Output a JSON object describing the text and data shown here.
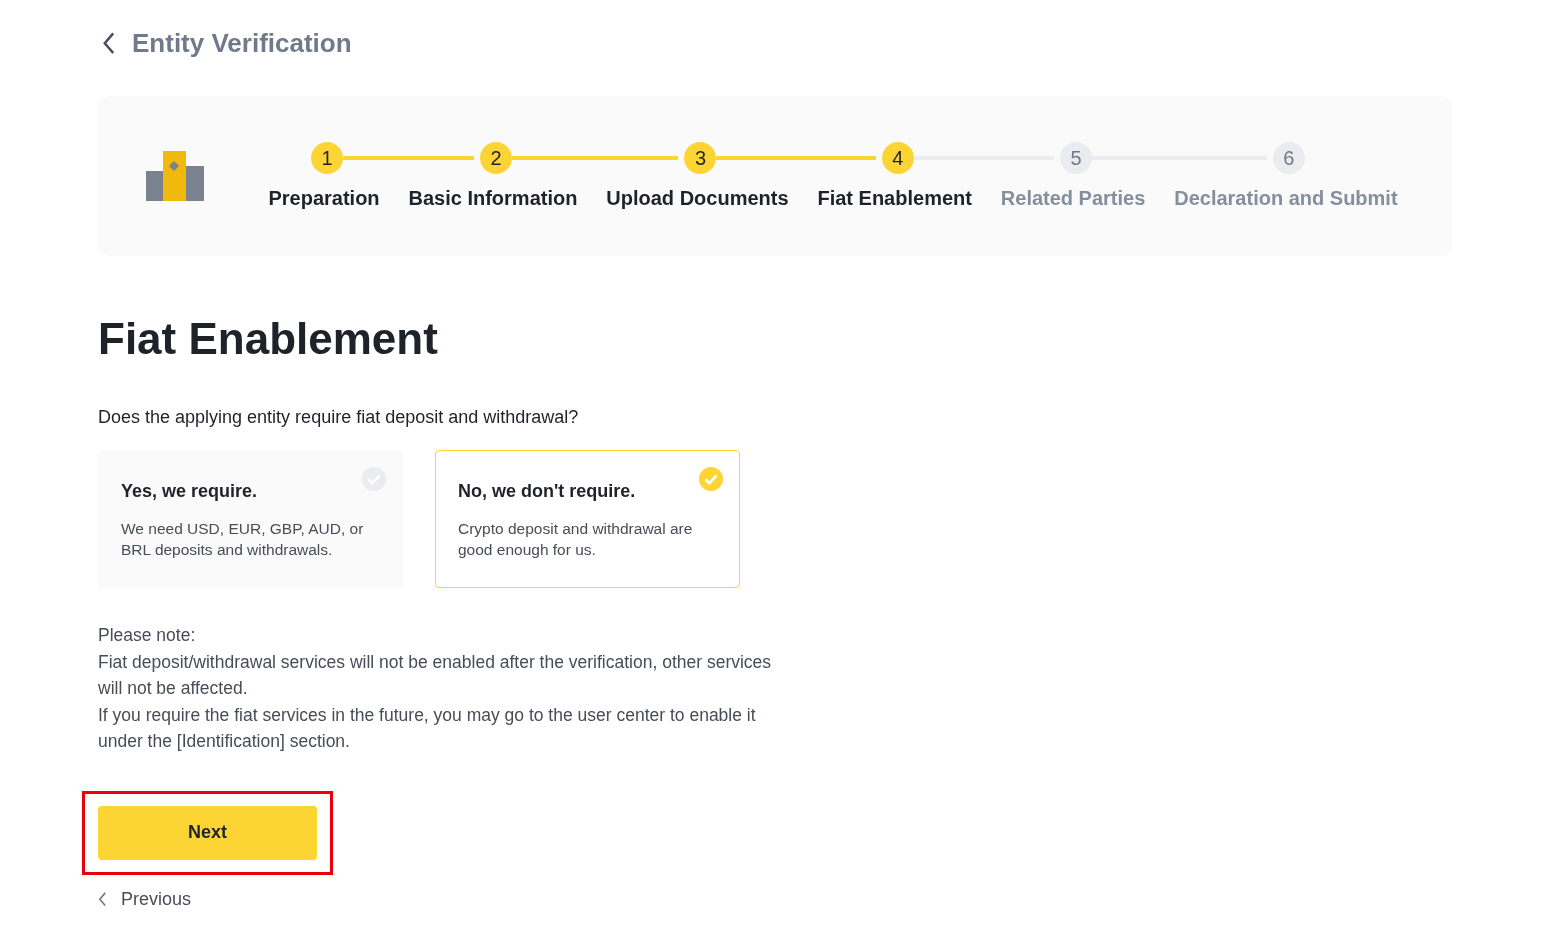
{
  "header": {
    "title": "Entity Verification"
  },
  "steps": [
    {
      "number": "1",
      "label": "Preparation",
      "completed": true
    },
    {
      "number": "2",
      "label": "Basic Information",
      "completed": true
    },
    {
      "number": "3",
      "label": "Upload Documents",
      "completed": true
    },
    {
      "number": "4",
      "label": "Fiat Enablement",
      "completed": true
    },
    {
      "number": "5",
      "label": "Related Parties",
      "completed": false
    },
    {
      "number": "6",
      "label": "Declaration and Submit",
      "completed": false
    }
  ],
  "heading": "Fiat Enablement",
  "question": "Does the applying entity require fiat deposit and withdrawal?",
  "options": [
    {
      "title": "Yes, we require.",
      "description": "We need USD, EUR, GBP, AUD, or BRL deposits and withdrawals.",
      "selected": false
    },
    {
      "title": "No, we don't require.",
      "description": "Crypto deposit and withdrawal are good enough for us.",
      "selected": true
    }
  ],
  "note": [
    "Please note:",
    "Fiat deposit/withdrawal services will not be enabled after the verification, other services will not be affected.",
    "If you require the fiat services in the future, you may go to the user center to enable it under the [Identification] section."
  ],
  "next_button": {
    "label": "Next",
    "highlighted": true
  },
  "previous_link": "Previous"
}
